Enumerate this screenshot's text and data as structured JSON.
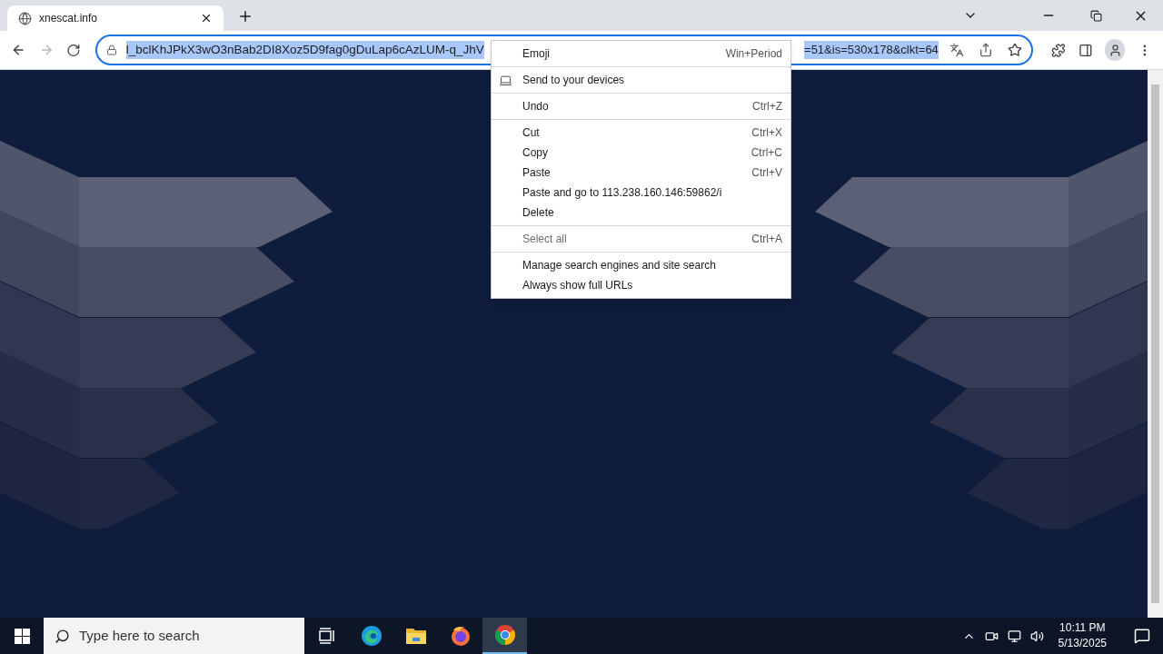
{
  "tabs": [
    {
      "title": "xnescat.info",
      "selected": true
    }
  ],
  "toolbar": {
    "back_disabled": false,
    "forward_disabled": true,
    "address": {
      "text_start": "l_bclKhJPkX3wO3nBab2DI8Xoz5D9fag0gDuLap6cAzLUM-q_JhV",
      "text_end": "=51&is=530x178&clkt=64",
      "selected": true
    }
  },
  "context_menu": [
    {
      "kind": "item",
      "label": "Emoji",
      "shortcut": "Win+Period",
      "disabled": false
    },
    {
      "kind": "separator"
    },
    {
      "kind": "icon_item",
      "label": "Send to your devices",
      "disabled": false
    },
    {
      "kind": "separator"
    },
    {
      "kind": "item",
      "label": "Undo",
      "shortcut": "Ctrl+Z",
      "disabled": false
    },
    {
      "kind": "separator"
    },
    {
      "kind": "item",
      "label": "Cut",
      "shortcut": "Ctrl+X",
      "disabled": false
    },
    {
      "kind": "item",
      "label": "Copy",
      "shortcut": "Ctrl+C",
      "disabled": false
    },
    {
      "kind": "item",
      "label": "Paste",
      "shortcut": "Ctrl+V",
      "disabled": false
    },
    {
      "kind": "item",
      "label": "Paste and go to 113.238.160.146:59862/i",
      "disabled": false
    },
    {
      "kind": "item",
      "label": "Delete",
      "disabled": false
    },
    {
      "kind": "separator"
    },
    {
      "kind": "item",
      "label": "Select all",
      "shortcut": "Ctrl+A",
      "disabled": true
    },
    {
      "kind": "separator"
    },
    {
      "kind": "item",
      "label": "Manage search engines and site search",
      "disabled": false
    },
    {
      "kind": "item",
      "label": "Always show full URLs",
      "disabled": false
    }
  ],
  "taskbar": {
    "search_placeholder": "Type here to search",
    "apps": [
      {
        "kind": "taskview",
        "selected": false
      },
      {
        "kind": "edge",
        "selected": false
      },
      {
        "kind": "explorer",
        "selected": false
      },
      {
        "kind": "firefox",
        "selected": false
      },
      {
        "kind": "chrome",
        "selected": true
      }
    ],
    "time": "10:11 PM",
    "date": "5/13/2025"
  }
}
